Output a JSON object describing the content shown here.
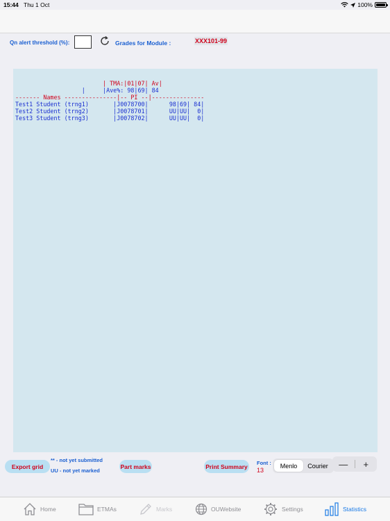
{
  "status_bar": {
    "time": "15:44",
    "date": "Thu 1 Oct",
    "battery": "100%"
  },
  "toolbar": {
    "threshold_label": "Qn alert threshold (%):",
    "threshold_value": "",
    "grades_label": "Grades for Module :",
    "module_code": "XXX101-99"
  },
  "grid": {
    "lines": [
      {
        "text": "                         | TMA:|01|07| Av|",
        "color": "#d0021b"
      },
      {
        "text": "                   |     |Ave%: 98|69| 84",
        "color": "#1a2fd0"
      },
      {
        "text": "------- Names ---------------|-- PI --|---------------",
        "color": "#d0021b"
      },
      {
        "text": "Test1 Student (trng1)       |J0078700|      98|69| 84|",
        "color": "#1a2fd0"
      },
      {
        "text": "Test2 Student (trng2)       |J0078701|      UU|UU|  0|",
        "color": "#1a2fd0"
      },
      {
        "text": "Test3 Student (trng3)       |J0078702|      UU|UU|  0|",
        "color": "#1a2fd0"
      }
    ]
  },
  "bottom": {
    "export_grid": "Export grid",
    "legend_not_submitted": "** - not yet submitted",
    "legend_not_marked": "UU - not yet marked",
    "part_marks": "Part marks",
    "print_summary": "Print Summary",
    "font_label": "Font :",
    "font_size": "13",
    "font_options": [
      "Menlo",
      "Courier"
    ],
    "stepper_minus": "—",
    "stepper_plus": "+"
  },
  "tabs": [
    {
      "label": "Home",
      "icon": "home-icon",
      "state": "normal"
    },
    {
      "label": "ETMAs",
      "icon": "folder-icon",
      "state": "normal"
    },
    {
      "label": "Marks",
      "icon": "pencil-icon",
      "state": "disabled"
    },
    {
      "label": "OUWebsite",
      "icon": "globe-icon",
      "state": "normal"
    },
    {
      "label": "Settings",
      "icon": "gear-icon",
      "state": "normal"
    },
    {
      "label": "Statistics",
      "icon": "bar-chart-icon",
      "state": "active"
    }
  ],
  "colors": {
    "accent": "#1a7ae6",
    "red": "#d0021b",
    "grid_bg": "#d4e7ef",
    "pill_bg": "#b9dff2"
  }
}
